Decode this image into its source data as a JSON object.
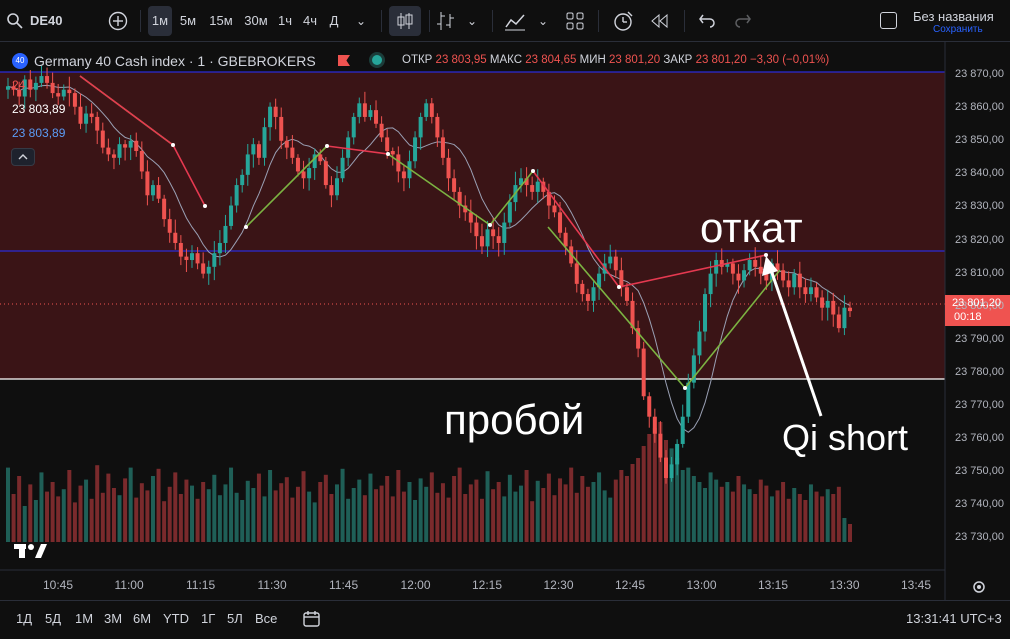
{
  "toolbar": {
    "symbol": "DE40",
    "intervals": [
      "1м",
      "5м",
      "15м",
      "30м",
      "1ч",
      "4ч",
      "Д"
    ],
    "active_interval": "1м",
    "layout_name": "Без названия",
    "layout_status": "Сохранить"
  },
  "legend": {
    "instrument": "Germany 40 Cash index · 1 · GBEBROKERS",
    "open_label": "ОТКР",
    "open": "23 803,95",
    "high_label": "МАКС",
    "high": "23 804,65",
    "low_label": "МИН",
    "low": "23 801,20",
    "close_label": "ЗАКР",
    "close": "23 801,20",
    "change": "−3,30 (−0,01%)",
    "indicator_value": "24",
    "bid": "23 803,89",
    "ask": "23 803,89"
  },
  "annotations": {
    "pullback": "откат",
    "breakout": "пробой",
    "signal": "Qi short"
  },
  "price_axis": {
    "labels": [
      "23 870,00",
      "23 860,00",
      "23 850,00",
      "23 840,00",
      "23 830,00",
      "23 820,00",
      "23 810,00",
      "23 800,00",
      "23 790,00",
      "23 780,00",
      "23 770,00",
      "23 760,00",
      "23 750,00",
      "23 740,00",
      "23 730,00"
    ],
    "current_price": "23 801,20",
    "countdown": "00:18"
  },
  "time_axis": {
    "labels": [
      "10:45",
      "11:00",
      "11:15",
      "11:30",
      "11:45",
      "12:00",
      "12:15",
      "12:30",
      "12:45",
      "13:00",
      "13:15",
      "13:30",
      "13:45"
    ]
  },
  "bottom": {
    "ranges": [
      "1Д",
      "5Д",
      "1М",
      "3М",
      "6М",
      "YTD",
      "1Г",
      "5Л",
      "Все"
    ],
    "clock": "13:31:41 UTC+3"
  },
  "colors": {
    "up": "#26a69a",
    "down": "#ef5350",
    "zone": "#3a1416",
    "pivot_up": "#8bc34a",
    "pivot_down": "#e53950"
  },
  "chart_data": {
    "type": "candlestick",
    "ylim": [
      23725,
      23880
    ],
    "closes": [
      23867,
      23866,
      23864,
      23869,
      23866,
      23868,
      23870,
      23868,
      23865,
      23864,
      23866,
      23865,
      23861,
      23856,
      23859,
      23858,
      23854,
      23849,
      23847,
      23846,
      23850,
      23849,
      23851,
      23848,
      23842,
      23835,
      23838,
      23834,
      23828,
      23824,
      23821,
      23817,
      23816,
      23818,
      23815,
      23812,
      23814,
      23818,
      23821,
      23826,
      23832,
      23838,
      23841,
      23847,
      23850,
      23846,
      23855,
      23861,
      23858,
      23851,
      23849,
      23846,
      23842,
      23840,
      23843,
      23847,
      23845,
      23838,
      23835,
      23840,
      23846,
      23852,
      23858,
      23862,
      23858,
      23860,
      23856,
      23852,
      23848,
      23847,
      23842,
      23840,
      23845,
      23852,
      23858,
      23862,
      23858,
      23852,
      23846,
      23840,
      23836,
      23832,
      23830,
      23827,
      23823,
      23820,
      23825,
      23823,
      23821,
      23827,
      23833,
      23838,
      23840,
      23838,
      23836,
      23839,
      23836,
      23832,
      23830,
      23824,
      23820,
      23815,
      23809,
      23806,
      23804,
      23808,
      23812,
      23815,
      23817,
      23813,
      23808,
      23804,
      23796,
      23790,
      23776,
      23770,
      23765,
      23758,
      23752,
      23756,
      23762,
      23770,
      23780,
      23788,
      23795,
      23806,
      23812,
      23816,
      23814,
      23815,
      23812,
      23810,
      23813,
      23816,
      23814,
      23812,
      23810,
      23815,
      23813,
      23810,
      23808,
      23812,
      23808,
      23806,
      23808,
      23805,
      23802,
      23804,
      23800,
      23796,
      23802,
      23801
    ],
    "volumes": [
      0.62,
      0.4,
      0.55,
      0.3,
      0.48,
      0.35,
      0.58,
      0.42,
      0.5,
      0.38,
      0.44,
      0.6,
      0.33,
      0.47,
      0.52,
      0.36,
      0.64,
      0.41,
      0.57,
      0.45,
      0.39,
      0.53,
      0.62,
      0.37,
      0.49,
      0.43,
      0.55,
      0.61,
      0.34,
      0.46,
      0.58,
      0.4,
      0.52,
      0.47,
      0.36,
      0.5,
      0.44,
      0.56,
      0.39,
      0.48,
      0.62,
      0.41,
      0.35,
      0.51,
      0.45,
      0.57,
      0.38,
      0.6,
      0.43,
      0.49,
      0.54,
      0.37,
      0.46,
      0.59,
      0.42,
      0.33,
      0.5,
      0.56,
      0.4,
      0.48,
      0.61,
      0.36,
      0.45,
      0.52,
      0.39,
      0.57,
      0.44,
      0.47,
      0.55,
      0.38,
      0.6,
      0.42,
      0.5,
      0.35,
      0.53,
      0.46,
      0.58,
      0.41,
      0.49,
      0.37,
      0.55,
      0.62,
      0.4,
      0.48,
      0.52,
      0.36,
      0.59,
      0.44,
      0.5,
      0.38,
      0.56,
      0.42,
      0.47,
      0.6,
      0.34,
      0.51,
      0.45,
      0.57,
      0.39,
      0.53,
      0.48,
      0.62,
      0.41,
      0.55,
      0.46,
      0.5,
      0.58,
      0.43,
      0.37,
      0.52,
      0.6,
      0.55,
      0.65,
      0.7,
      0.8,
      0.9,
      0.95,
      1.0,
      0.85,
      0.78,
      0.7,
      0.6,
      0.62,
      0.55,
      0.5,
      0.45,
      0.58,
      0.52,
      0.46,
      0.5,
      0.42,
      0.55,
      0.48,
      0.44,
      0.4,
      0.52,
      0.47,
      0.38,
      0.43,
      0.5,
      0.36,
      0.45,
      0.4,
      0.35,
      0.48,
      0.42,
      0.38,
      0.44,
      0.4,
      0.46,
      0.2,
      0.15
    ]
  }
}
